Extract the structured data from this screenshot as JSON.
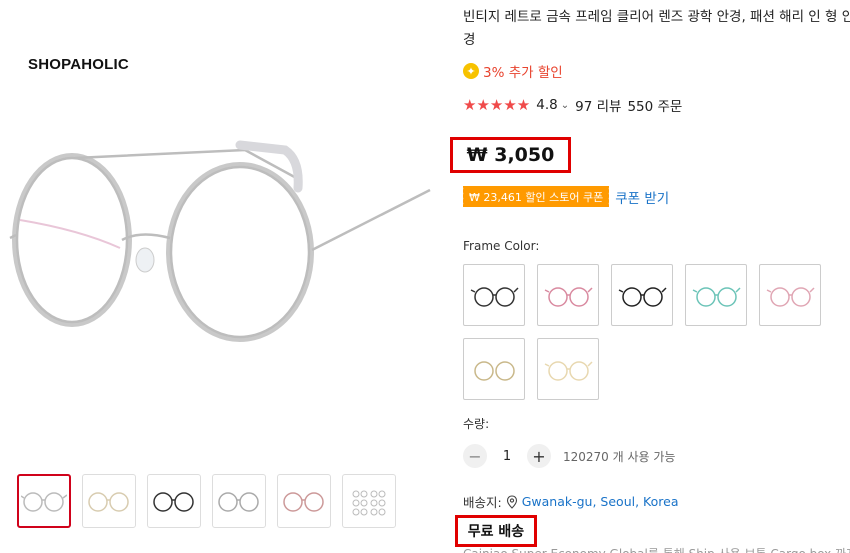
{
  "brand": "SHOPAHOLIC",
  "product": {
    "title": "빈티지 레트로 금속 프레임 클리어 렌즈 광학 안경, 패션 해리 인 형 안경",
    "extra_discount": "3% 추가 할인",
    "rating": "4.8",
    "reviews": "97 리뷰",
    "orders": "550 주문",
    "price": "₩ 3,050",
    "coupon_badge": "₩ 23,461 할인 스토어 쿠폰",
    "coupon_link": "쿠폰 받기"
  },
  "options": {
    "frame_label": "Frame Color:",
    "swatches": [
      {
        "name": "black-silver",
        "color": "#222222"
      },
      {
        "name": "pink",
        "color": "#d98aa0"
      },
      {
        "name": "black",
        "color": "#333333"
      },
      {
        "name": "green",
        "color": "#6cc4b8"
      },
      {
        "name": "pink-light",
        "color": "#e0a6b4"
      },
      {
        "name": "gold",
        "color": "#c9b88a"
      },
      {
        "name": "white-gold",
        "color": "#e8d8b0"
      }
    ]
  },
  "quantity": {
    "label": "수량:",
    "value": "1",
    "available": "120270 개 사용 가능"
  },
  "shipping": {
    "label": "배송지:",
    "location": "Gwanak-gu, Seoul, Korea",
    "free_label": "무료 배송",
    "detail_cut": "Cainiao Super Economy Global를 통해 Ship 사용 보통 Cargo box 까지"
  },
  "colors": {
    "accent_red": "#e00000",
    "coupon_orange": "#ff9a00",
    "link_blue": "#1a73c8",
    "star_red": "#f04a4a"
  }
}
